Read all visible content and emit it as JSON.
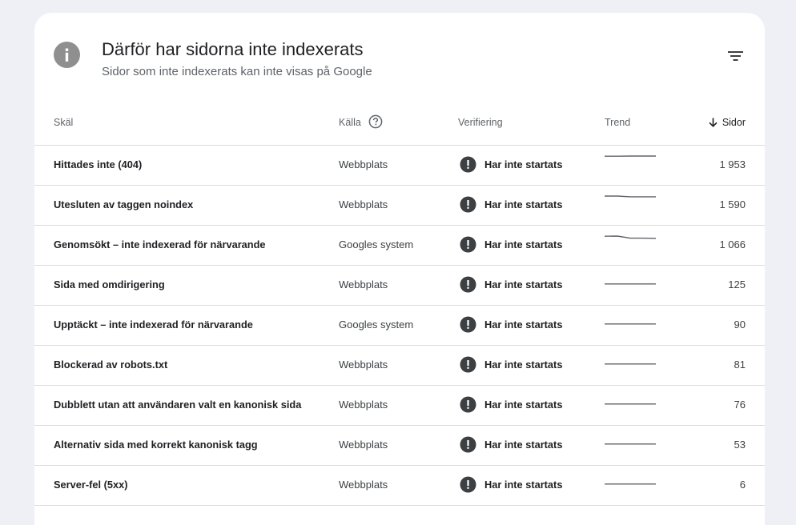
{
  "header": {
    "title": "Därför har sidorna inte indexerats",
    "subtitle": "Sidor som inte indexerats kan inte visas på Google",
    "icon": "info-icon",
    "filter_icon": "filter-icon"
  },
  "table": {
    "columns": {
      "reason": "Skäl",
      "source": "Källa",
      "verification": "Verifiering",
      "trend": "Trend",
      "pages": "Sidor"
    },
    "sort": {
      "column": "pages",
      "direction": "descending",
      "icon": "arrow-down-icon"
    },
    "rows": [
      {
        "reason": "Hittades inte (404)",
        "source": "Webbplats",
        "verification": "Har inte startats",
        "trend": [
          0.9,
          0.9,
          0.92,
          0.92,
          0.92
        ],
        "pages": "1 953"
      },
      {
        "reason": "Utesluten av taggen noindex",
        "source": "Webbplats",
        "verification": "Har inte startats",
        "trend": [
          0.92,
          0.92,
          0.84,
          0.84,
          0.84
        ],
        "pages": "1 590"
      },
      {
        "reason": "Genomsökt – inte indexerad för närvarande",
        "source": "Googles system",
        "verification": "Har inte startats",
        "trend": [
          0.9,
          0.92,
          0.7,
          0.7,
          0.68
        ],
        "pages": "1 066"
      },
      {
        "reason": "Sida med omdirigering",
        "source": "Webbplats",
        "verification": "Har inte startats",
        "trend": [
          0.1,
          0.1,
          0.1,
          0.1,
          0.1
        ],
        "pages": "125"
      },
      {
        "reason": "Upptäckt – inte indexerad för närvarande",
        "source": "Googles system",
        "verification": "Har inte startats",
        "trend": [
          0.1,
          0.1,
          0.1,
          0.1,
          0.1
        ],
        "pages": "90"
      },
      {
        "reason": "Blockerad av robots.txt",
        "source": "Webbplats",
        "verification": "Har inte startats",
        "trend": [
          0.1,
          0.1,
          0.1,
          0.1,
          0.1
        ],
        "pages": "81"
      },
      {
        "reason": "Dubblett utan att användaren valt en kanonisk sida",
        "source": "Webbplats",
        "verification": "Har inte startats",
        "trend": [
          0.1,
          0.1,
          0.1,
          0.1,
          0.1
        ],
        "pages": "76"
      },
      {
        "reason": "Alternativ sida med korrekt kanonisk tagg",
        "source": "Webbplats",
        "verification": "Har inte startats",
        "trend": [
          0.1,
          0.1,
          0.1,
          0.1,
          0.1
        ],
        "pages": "53"
      },
      {
        "reason": "Server-fel (5xx)",
        "source": "Webbplats",
        "verification": "Har inte startats",
        "trend": [
          0.1,
          0.1,
          0.1,
          0.1,
          0.1
        ],
        "pages": "6"
      }
    ]
  },
  "colors": {
    "background": "#eef0f5",
    "card": "#ffffff",
    "status_icon": "#3c4043",
    "info_icon": "#8f8f8f",
    "sparkline": "#5f6368",
    "divider": "#dadce0"
  }
}
